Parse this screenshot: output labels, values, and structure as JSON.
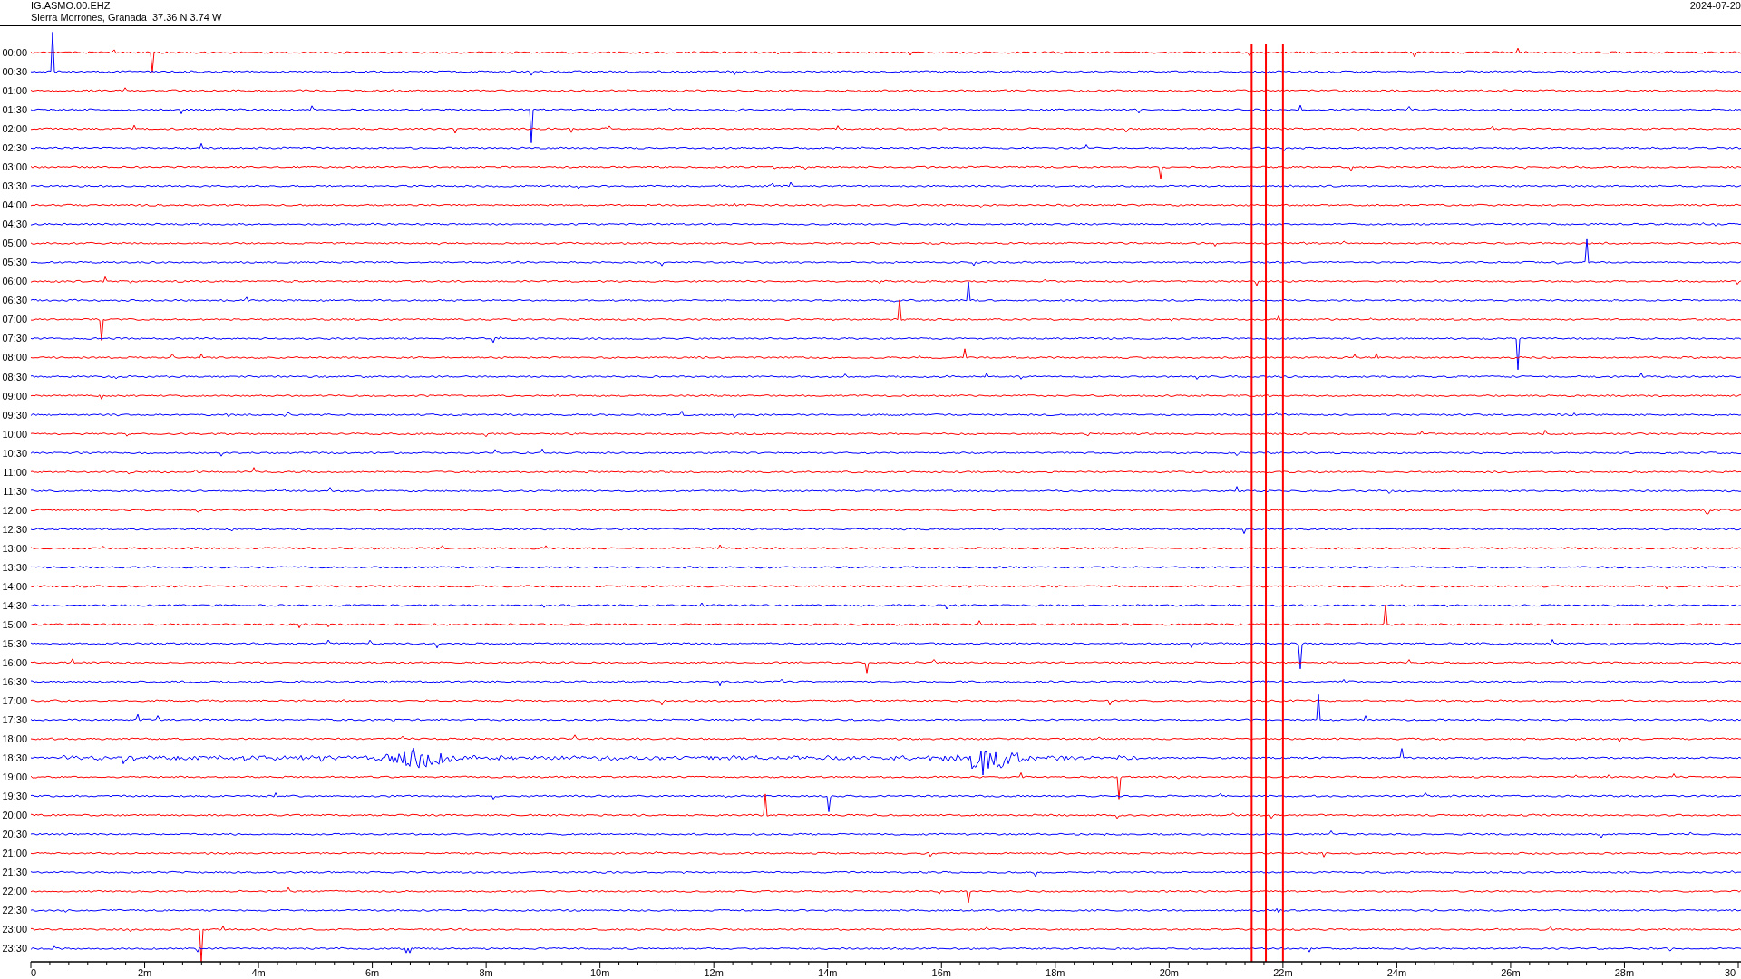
{
  "header": {
    "station": "IG.ASMO.00.EHZ",
    "location": "Sierra Morrones, Granada  37.36 N 3.74 W",
    "date": "2024-07-20"
  },
  "rows": [
    {
      "label": "00:00",
      "color": "#ff0000"
    },
    {
      "label": "00:30",
      "color": "#0000ff"
    },
    {
      "label": "01:00",
      "color": "#ff0000"
    },
    {
      "label": "01:30",
      "color": "#0000ff"
    },
    {
      "label": "02:00",
      "color": "#ff0000"
    },
    {
      "label": "02:30",
      "color": "#0000ff"
    },
    {
      "label": "03:00",
      "color": "#ff0000"
    },
    {
      "label": "03:30",
      "color": "#0000ff"
    },
    {
      "label": "04:00",
      "color": "#ff0000"
    },
    {
      "label": "04:30",
      "color": "#0000ff"
    },
    {
      "label": "05:00",
      "color": "#ff0000"
    },
    {
      "label": "05:30",
      "color": "#0000ff"
    },
    {
      "label": "06:00",
      "color": "#ff0000"
    },
    {
      "label": "06:30",
      "color": "#0000ff"
    },
    {
      "label": "07:00",
      "color": "#ff0000"
    },
    {
      "label": "07:30",
      "color": "#0000ff"
    },
    {
      "label": "08:00",
      "color": "#ff0000"
    },
    {
      "label": "08:30",
      "color": "#0000ff"
    },
    {
      "label": "09:00",
      "color": "#ff0000"
    },
    {
      "label": "09:30",
      "color": "#0000ff"
    },
    {
      "label": "10:00",
      "color": "#ff0000"
    },
    {
      "label": "10:30",
      "color": "#0000ff"
    },
    {
      "label": "11:00",
      "color": "#ff0000"
    },
    {
      "label": "11:30",
      "color": "#0000ff"
    },
    {
      "label": "12:00",
      "color": "#ff0000"
    },
    {
      "label": "12:30",
      "color": "#0000ff"
    },
    {
      "label": "13:00",
      "color": "#ff0000"
    },
    {
      "label": "13:30",
      "color": "#0000ff"
    },
    {
      "label": "14:00",
      "color": "#ff0000"
    },
    {
      "label": "14:30",
      "color": "#0000ff"
    },
    {
      "label": "15:00",
      "color": "#ff0000"
    },
    {
      "label": "15:30",
      "color": "#0000ff"
    },
    {
      "label": "16:00",
      "color": "#ff0000"
    },
    {
      "label": "16:30",
      "color": "#0000ff"
    },
    {
      "label": "17:00",
      "color": "#ff0000"
    },
    {
      "label": "17:30",
      "color": "#0000ff"
    },
    {
      "label": "18:00",
      "color": "#ff0000"
    },
    {
      "label": "18:30",
      "color": "#0000ff"
    },
    {
      "label": "19:00",
      "color": "#ff0000"
    },
    {
      "label": "19:30",
      "color": "#0000ff"
    },
    {
      "label": "20:00",
      "color": "#ff0000"
    },
    {
      "label": "20:30",
      "color": "#0000ff"
    },
    {
      "label": "21:00",
      "color": "#ff0000"
    },
    {
      "label": "21:30",
      "color": "#0000ff"
    },
    {
      "label": "22:00",
      "color": "#ff0000"
    },
    {
      "label": "22:30",
      "color": "#0000ff"
    },
    {
      "label": "23:00",
      "color": "#ff0000"
    },
    {
      "label": "23:30",
      "color": "#0000ff"
    }
  ],
  "x_axis": {
    "ticks": [
      "0",
      "2m",
      "4m",
      "6m",
      "8m",
      "10m",
      "12m",
      "14m",
      "16m",
      "18m",
      "20m",
      "22m",
      "24m",
      "26m",
      "28m",
      "30"
    ]
  }
}
